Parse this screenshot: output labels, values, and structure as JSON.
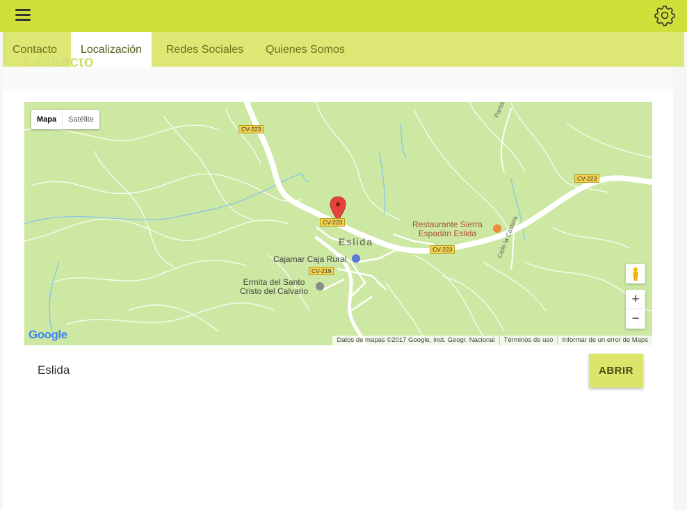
{
  "tabs": [
    {
      "label": "Contacto"
    },
    {
      "label": "Localización"
    },
    {
      "label": "Redes Sociales"
    },
    {
      "label": "Quienes Somos"
    }
  ],
  "active_tab": "Localización",
  "page_title": "Contacto",
  "map": {
    "type_controls": {
      "map": "Mapa",
      "satellite": "Satélite"
    },
    "road_shields": [
      "CV-223",
      "CV-223",
      "CV-223",
      "CV-223",
      "CV-219"
    ],
    "labels": {
      "town": "Eslida",
      "poi_restaurant": [
        "Restaurante Sierra",
        "Espadán Eslida"
      ],
      "poi_bank": "Cajamar Caja Rural",
      "poi_hermitage": [
        "Ermita del Santo",
        "Cristo del Calvario"
      ],
      "street_costera": "Calle la Costera",
      "street_partida": "Partida"
    },
    "zoom_in": "+",
    "zoom_out": "−",
    "logo": "Google",
    "attribution": {
      "data": "Datos de mapas ©2017 Google, Inst. Geogr. Nacional",
      "terms": "Términos de uso",
      "report": "Informar de un error de Maps"
    }
  },
  "place": {
    "name": "Eslida"
  },
  "open_button": "ABRIR",
  "colors": {
    "topbar": "#d1df3a",
    "tabs_bg": "#dde774",
    "button": "#dbe56a",
    "map_bg": "#cce8a2",
    "marker": "#e5433a"
  },
  "icons": {
    "menu": "menu-icon",
    "settings": "gear-icon",
    "marker": "map-marker-icon",
    "pegman": "pegman-icon"
  }
}
